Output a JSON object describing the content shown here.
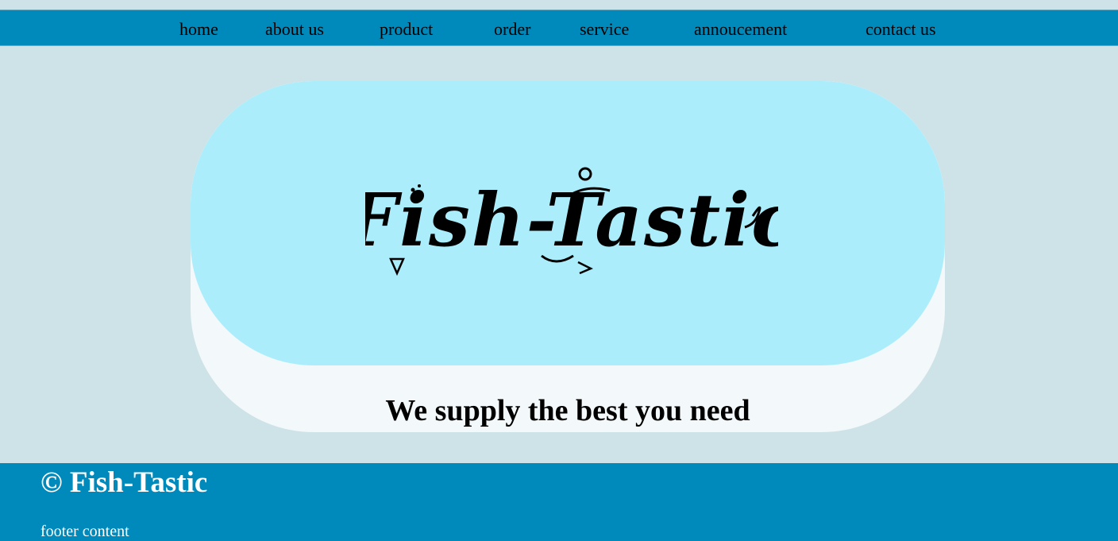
{
  "nav": {
    "items": [
      {
        "label": "home"
      },
      {
        "label": "about us"
      },
      {
        "label": "product"
      },
      {
        "label": "order"
      },
      {
        "label": "service"
      },
      {
        "label": "annoucement"
      },
      {
        "label": "contact us"
      }
    ]
  },
  "hero": {
    "logo_text": "Fish-Tastic",
    "tagline": "We supply the best you need"
  },
  "footer": {
    "title": "© Fish-Tastic",
    "content": "footer content"
  },
  "colors": {
    "page_background": "#cde3e8",
    "nav_background": "#0089bb",
    "hero_card": "#f3f8fa",
    "hero_banner": "#acedfb",
    "footer_background": "#0089bb"
  }
}
